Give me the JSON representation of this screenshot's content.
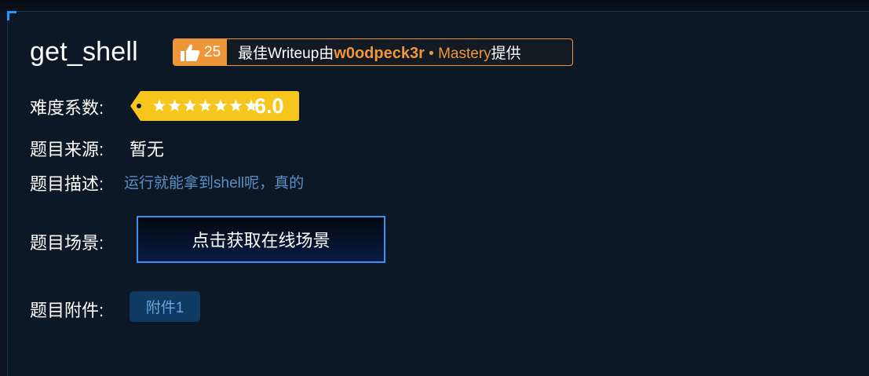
{
  "challenge": {
    "title": "get_shell"
  },
  "writeup": {
    "likes": "25",
    "prefix": "最佳Writeup由",
    "author": "w0odpeck3r",
    "dot": "•",
    "rank": "Mastery",
    "suffix": "提供"
  },
  "difficulty": {
    "label": "难度系数:",
    "value": "6.0",
    "stars": 7
  },
  "source": {
    "label": "题目来源:",
    "value": "暂无"
  },
  "description": {
    "label": "题目描述:",
    "value": "运行就能拿到shell呢，真的"
  },
  "scene": {
    "label": "题目场景:",
    "button": "点击获取在线场景"
  },
  "attachments": {
    "label": "题目附件:",
    "items": [
      "附件1"
    ]
  },
  "colors": {
    "background": "#0d1826",
    "accent_orange": "#f0963a",
    "tag_yellow": "#f6c61c",
    "button_border": "#3d8ff2",
    "link_blue": "#5d8fc7"
  }
}
